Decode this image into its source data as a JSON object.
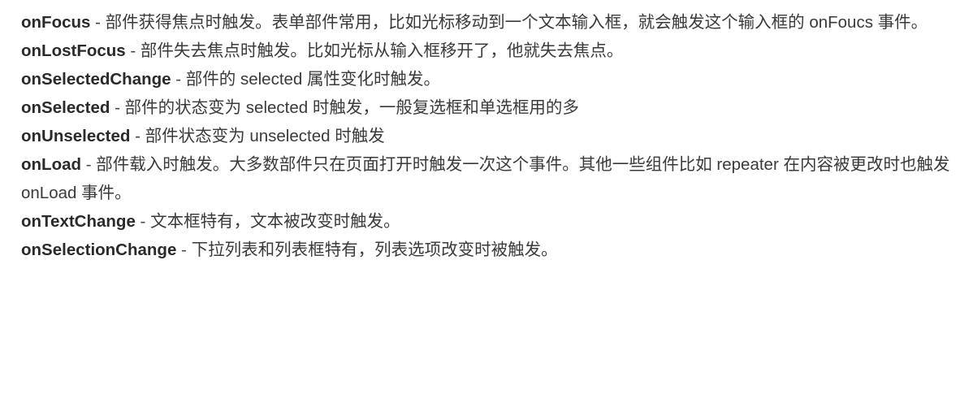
{
  "separator": " - ",
  "events": [
    {
      "term": "onFocus",
      "description": "部件获得焦点时触发。表单部件常用，比如光标移动到一个文本输入框，就会触发这个输入框的 onFoucs 事件。"
    },
    {
      "term": "onLostFocus",
      "description": "部件失去焦点时触发。比如光标从输入框移开了，他就失去焦点。"
    },
    {
      "term": "onSelectedChange",
      "description": "部件的 selected 属性变化时触发。"
    },
    {
      "term": "onSelected",
      "description": "部件的状态变为 selected 时触发，一般复选框和单选框用的多"
    },
    {
      "term": "onUnselected",
      "description": "部件状态变为 unselected 时触发"
    },
    {
      "term": "onLoad",
      "description": "部件载入时触发。大多数部件只在页面打开时触发一次这个事件。其他一些组件比如 repeater 在内容被更改时也触发 onLoad 事件。"
    },
    {
      "term": "onTextChange",
      "description": "文本框特有，文本被改变时触发。"
    },
    {
      "term": "onSelectionChange",
      "description": "下拉列表和列表框特有，列表选项改变时被触发。"
    }
  ]
}
